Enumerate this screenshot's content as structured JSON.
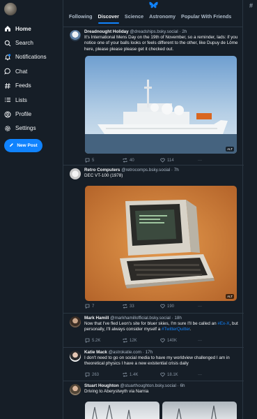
{
  "sidebar": {
    "items": [
      {
        "label": "Home",
        "icon": "home-icon"
      },
      {
        "label": "Search",
        "icon": "search-icon"
      },
      {
        "label": "Notifications",
        "icon": "bell-icon"
      },
      {
        "label": "Chat",
        "icon": "chat-icon"
      },
      {
        "label": "Feeds",
        "icon": "hash-icon"
      },
      {
        "label": "Lists",
        "icon": "list-icon"
      },
      {
        "label": "Profile",
        "icon": "user-icon"
      },
      {
        "label": "Settings",
        "icon": "gear-icon"
      }
    ],
    "new_post_label": "New Post"
  },
  "header": {
    "tabs": [
      "Following",
      "Discover",
      "Science",
      "Astronomy",
      "Popular With Friends"
    ],
    "active_tab": "Discover"
  },
  "posts": [
    {
      "name": "Dreadnought Holiday",
      "handle": "@dreadships.bsky.social",
      "time": "· 2h",
      "text": "It's International Mens Day on the 19th of November, so a reminder, lads: if you notice one of your balls looks or feels different to the other, like Dupuy de Lôme here, please please please get it checked out.",
      "counts": {
        "reply": "5",
        "repost": "40",
        "like": "114"
      },
      "alt": "ALT"
    },
    {
      "name": "Retro Computers",
      "handle": "@retrocomps.bsky.social",
      "time": "· 7h",
      "text": "DEC VT-100 (1978)",
      "counts": {
        "reply": "7",
        "repost": "33",
        "like": "190"
      },
      "alt": "ALT"
    },
    {
      "name": "Mark Hamill",
      "handle": "@markhamillofficial.bsky.social",
      "time": "· 18h",
      "text_a": "Now that I've fled Leon's site for bluer skies, I'm sure I'll be called an ",
      "link_a": "#Ex-X",
      "text_b": ", but personally, I'll always consider myself a ",
      "link_b": "#TwitterQuitter",
      "text_c": ".",
      "counts": {
        "reply": "5.2K",
        "repost": "12K",
        "like": "140K"
      }
    },
    {
      "name": "Katie Mack",
      "handle": "@astrokatie.com",
      "time": "· 17h",
      "text": "I don't need to go on social media to have my worldview challenged I am in theoretical physics I have a new existential crisis daily",
      "counts": {
        "reply": "263",
        "repost": "1.4K",
        "like": "18.1K"
      }
    },
    {
      "name": "Stuart Houghton",
      "handle": "@stuarthoughton.bsky.social",
      "time": "· 6h",
      "text": "Driving to Aberystwyth via Narnia"
    }
  ],
  "more_label": "···",
  "colors": {
    "background": "#161e27",
    "accent": "#1083fe",
    "border": "#2a3642",
    "muted": "#8794a3"
  }
}
